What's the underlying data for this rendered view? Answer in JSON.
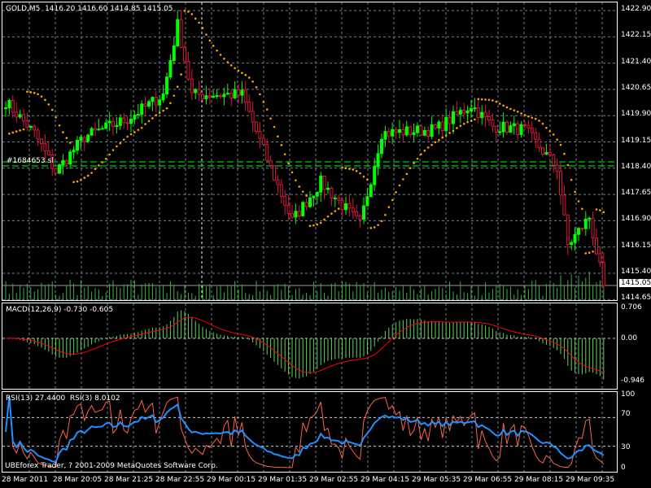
{
  "main": {
    "symbol_label": "GOLD,M5  1416.20 1416.60 1414.85 1415.05",
    "order_label": "#1684653 sl",
    "current_price": "1415.05",
    "price_ticks": [
      "1422.90",
      "1422.15",
      "1421.40",
      "1420.65",
      "1419.90",
      "1419.15",
      "1418.40",
      "1417.65",
      "1416.90",
      "1416.15",
      "1415.40",
      "1414.65"
    ],
    "price_path": [
      [
        0,
        1420.3
      ],
      [
        8,
        1419.4
      ],
      [
        14,
        1418.3
      ],
      [
        22,
        1419.3
      ],
      [
        34,
        1419.8
      ],
      [
        44,
        1420.5
      ],
      [
        48,
        1422.5
      ],
      [
        52,
        1420.5
      ],
      [
        66,
        1420.5
      ],
      [
        74,
        1418.4
      ],
      [
        80,
        1416.9
      ],
      [
        88,
        1418.0
      ],
      [
        99,
        1416.8
      ],
      [
        105,
        1419.4
      ],
      [
        120,
        1419.5
      ],
      [
        130,
        1420.2
      ],
      [
        136,
        1419.6
      ],
      [
        145,
        1419.5
      ],
      [
        154,
        1418.4
      ],
      [
        157,
        1416.2
      ],
      [
        163,
        1417.0
      ],
      [
        167,
        1415.05
      ]
    ],
    "colors": {
      "up": "#00ff00",
      "down": "#dc143c",
      "sar": "#ffa500",
      "grid": "#708090",
      "signal": "#ff0000",
      "rsi_fast": "#ff6347",
      "rsi_slow": "#1e90ff"
    }
  },
  "macd": {
    "label": "MACD(12,26,9) -0.730 -0.605",
    "ticks": [
      "0.706",
      "0.00",
      "-0.946"
    ]
  },
  "rsi": {
    "label": "RSI(13) 27.4400  RSI(3) 8.0102",
    "ticks": [
      "100",
      "70",
      "30",
      "0"
    ],
    "copyright": "UBEforex Trader, ? 2001-2009 MetaQuotes Software Corp."
  },
  "time_labels": [
    "28 Mar 2011",
    "28 Mar 20:05",
    "28 Mar 21:25",
    "28 Mar 22:55",
    "29 Mar 00:15",
    "29 Mar 01:35",
    "29 Mar 02:55",
    "29 Mar 04:15",
    "29 Mar 05:35",
    "29 Mar 06:55",
    "29 Mar 08:15",
    "29 Mar 09:35"
  ]
}
